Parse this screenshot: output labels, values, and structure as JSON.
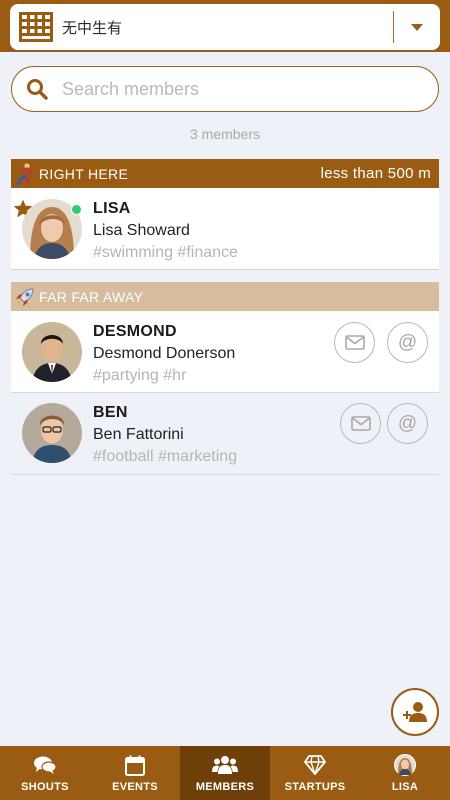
{
  "header": {
    "org_name": "无中生有",
    "logo_icon": "gate-logo-icon",
    "caret_icon": "chevron-down-icon"
  },
  "search": {
    "placeholder": "Search members"
  },
  "member_count": "3 members",
  "sections": [
    {
      "title": "RIGHT HERE",
      "distance": "less than 500 m",
      "icon": "runner-icon",
      "color": "#9a5c13"
    },
    {
      "title": "FAR FAR AWAY",
      "icon": "rocket-icon",
      "color": "#d5bd9d"
    }
  ],
  "members": [
    {
      "nickname": "LISA",
      "full_name": "Lisa Showard",
      "tags": "#swimming #finance",
      "starred": true,
      "online": true
    },
    {
      "nickname": "DESMOND",
      "full_name": "Desmond Donerson",
      "tags": "#partying #hr",
      "email_icon": "envelope-icon",
      "mention_icon": "at-icon",
      "mention_glyph": "@"
    },
    {
      "nickname": "BEN",
      "full_name": "Ben Fattorini",
      "tags": "#football #marketing",
      "email_icon": "envelope-icon",
      "mention_icon": "at-icon",
      "mention_glyph": "@"
    }
  ],
  "fab": {
    "icon": "add-user-icon"
  },
  "nav": [
    {
      "label": "SHOUTS",
      "icon": "chat-bubbles-icon",
      "active": false
    },
    {
      "label": "EVENTS",
      "icon": "calendar-icon",
      "active": false
    },
    {
      "label": "MEMBERS",
      "icon": "users-icon",
      "active": true
    },
    {
      "label": "STARTUPS",
      "icon": "diamond-icon",
      "active": false
    },
    {
      "label": "LISA",
      "icon": "profile-avatar-icon",
      "active": false
    }
  ],
  "colors": {
    "brand": "#9a5c13",
    "brand_dark": "#6e3f08",
    "background": "#eef1f8",
    "online": "#2ecc71",
    "tag": "#b5b5b5"
  }
}
